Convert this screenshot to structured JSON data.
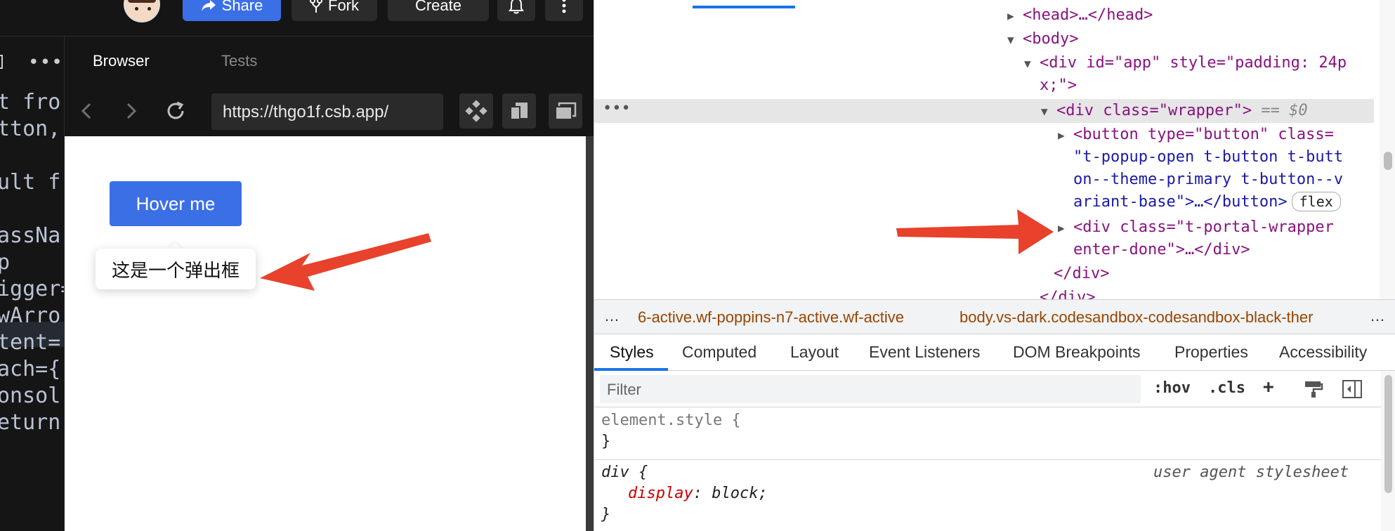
{
  "topbar": {
    "share_label": "Share",
    "fork_label": "Fork",
    "create_label": "Create"
  },
  "code_lines": [
    "t fro",
    "tton,",
    "",
    "ult f",
    "",
    "assNa",
    "p",
    "igger=",
    "wArro",
    "tent=",
    "ach={",
    "onsol",
    "eturn"
  ],
  "preview_tabs": {
    "browser": "Browser",
    "tests": "Tests"
  },
  "browser": {
    "url": "https://thgo1f.csb.app/",
    "hover_button": "Hover me",
    "popup_text": "这是一个弹出框"
  },
  "dom_tree": {
    "head": "<head>…</head>",
    "body_open": "<body>",
    "div_app_1": "<div id=\"app\" style=\"padding: 24p",
    "div_app_2": "x;\">",
    "div_wrapper": "<div class=\"wrapper\">",
    "selected_marker": "== $0",
    "button_1": "<button type=\"button\" class=",
    "button_2": "\"t-popup-open t-button t-butt",
    "button_3": "on--theme-primary t-button--v",
    "button_4": "ariant-base\">…</button>",
    "flex_badge": "flex",
    "portal_1": "<div class=\"t-portal-wrapper",
    "portal_2": "enter-done\">…</div>",
    "div_close": "</div>",
    "div_close_partial": "</div>"
  },
  "breadcrumbs": {
    "left_ellipsis": "…",
    "html_crumb": "6-active.wf-poppins-n7-active.wf-active",
    "body_crumb": "body.vs-dark.codesandbox-codesandbox-black-ther",
    "right_ellipsis": "…"
  },
  "style_tabs": [
    "Styles",
    "Computed",
    "Layout",
    "Event Listeners",
    "DOM Breakpoints",
    "Properties",
    "Accessibility"
  ],
  "filter": {
    "placeholder": "Filter",
    "hov": ":hov",
    "cls": ".cls",
    "plus": "+"
  },
  "styles_pane": {
    "element_style": "element.style {",
    "close_brace_1": "}",
    "div_selector": "div {",
    "ua_label": "user agent stylesheet",
    "prop_name": "display",
    "prop_value": "block;",
    "close_brace_2": "}"
  },
  "colors": {
    "accent": "#3b6fe6",
    "annotation_arrow": "#e8412c",
    "devtools_tab_accent": "#1a73e8"
  }
}
